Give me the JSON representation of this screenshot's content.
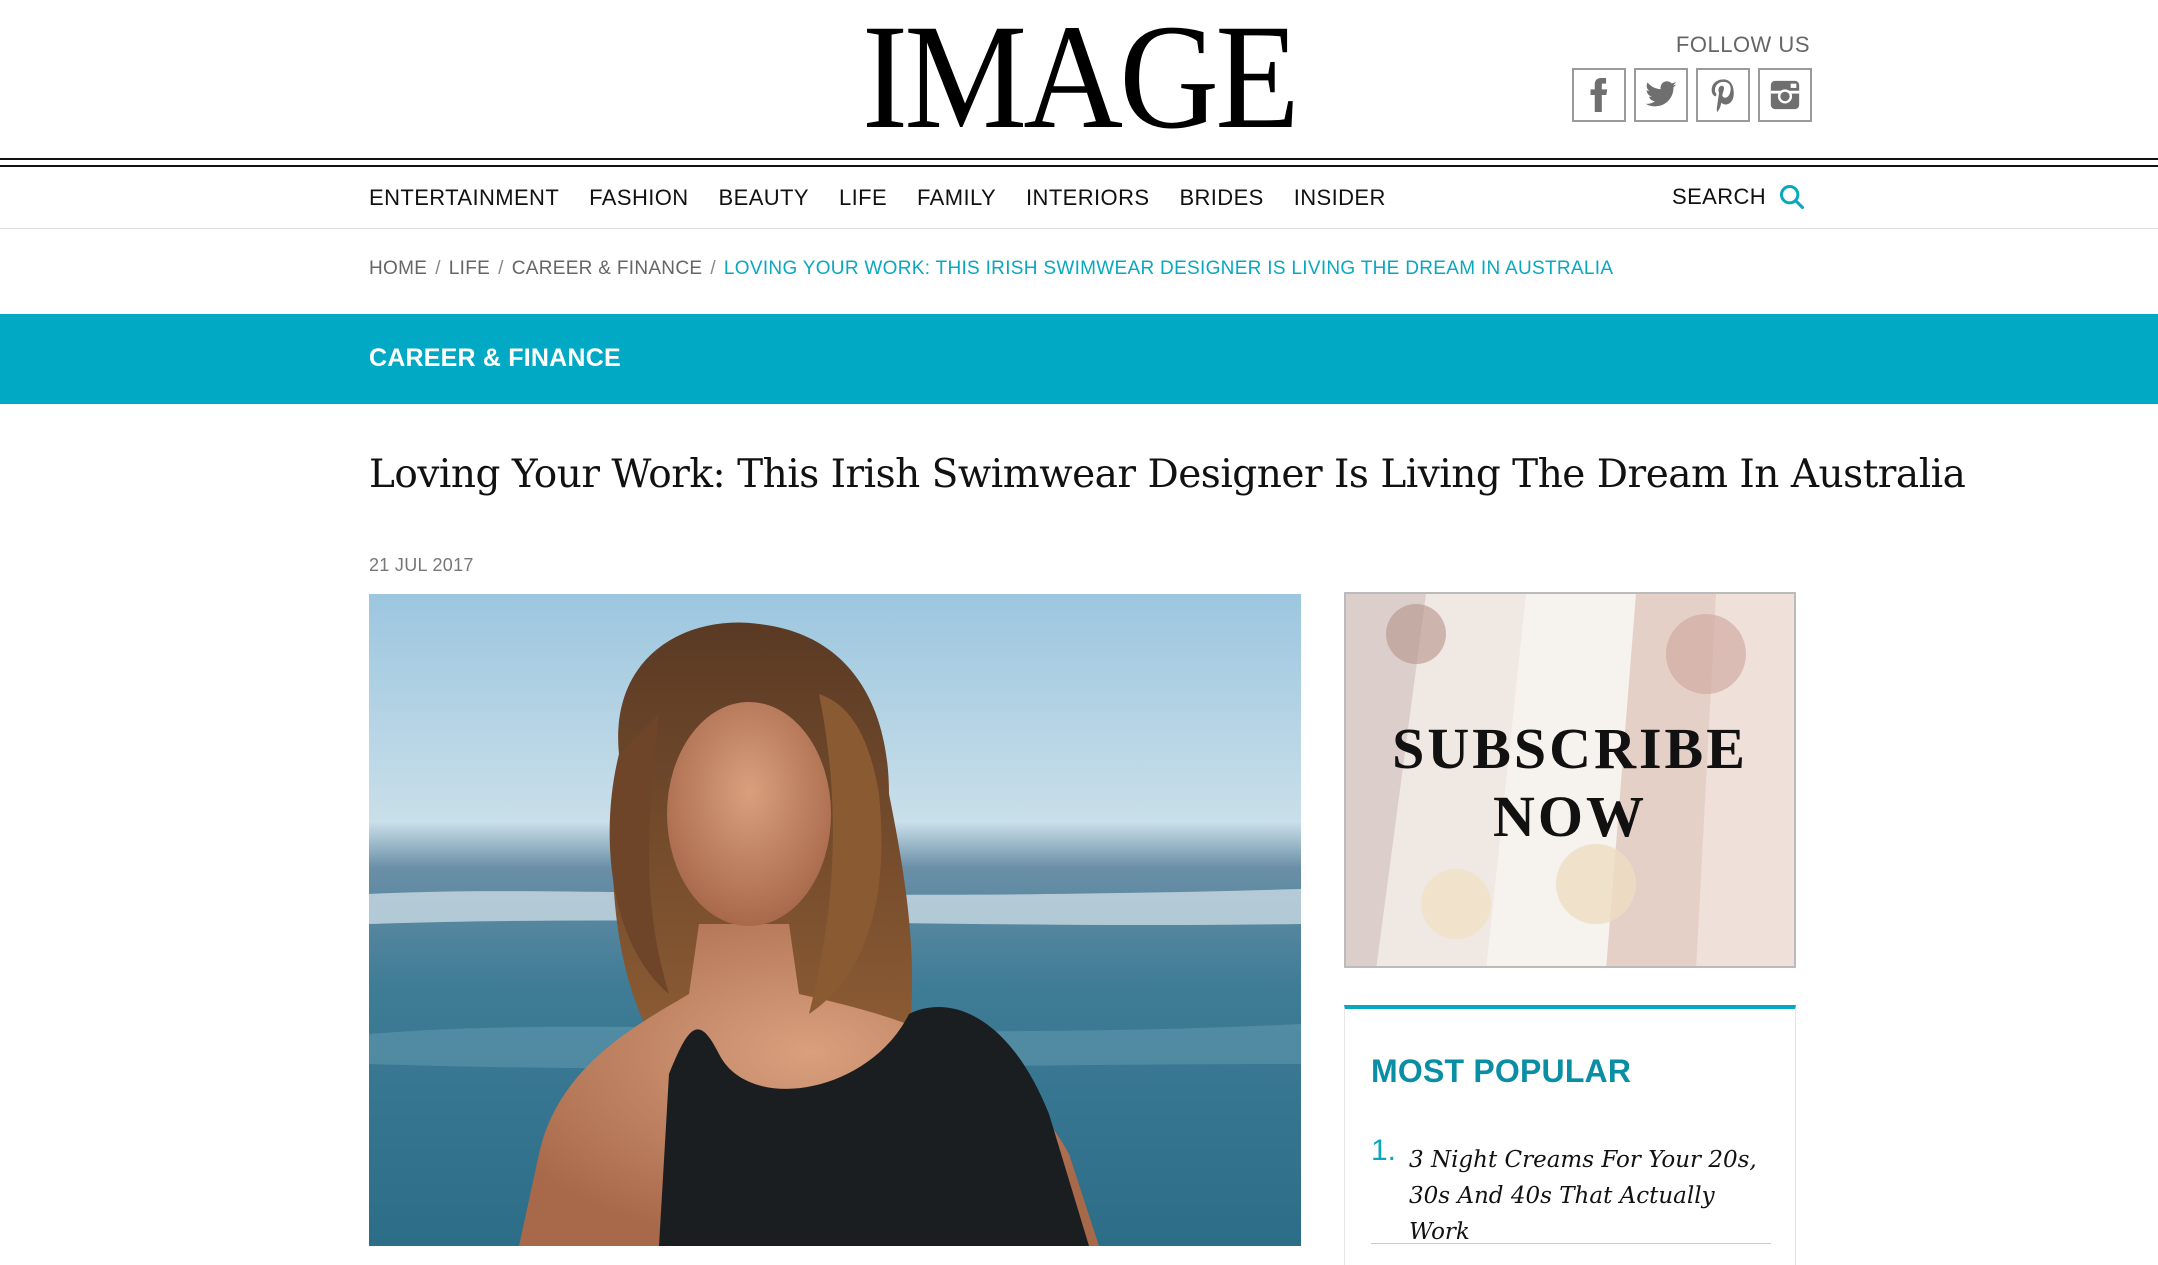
{
  "site": {
    "logo": "IMAGE",
    "follow_label": "FOLLOW US",
    "social_icons": [
      "facebook-icon",
      "twitter-icon",
      "pinterest-icon",
      "instagram-icon"
    ]
  },
  "nav": {
    "items": [
      "ENTERTAINMENT",
      "FASHION",
      "BEAUTY",
      "LIFE",
      "FAMILY",
      "INTERIORS",
      "BRIDES",
      "INSIDER"
    ],
    "search_label": "SEARCH"
  },
  "breadcrumb": {
    "items": [
      "HOME",
      "LIFE",
      "CAREER & FINANCE"
    ],
    "current": "LOVING YOUR WORK: THIS IRISH SWIMWEAR DESIGNER IS LIVING THE DREAM IN AUSTRALIA",
    "separator": "/"
  },
  "category_band": {
    "label": "CAREER & FINANCE",
    "color": "#01a9c5"
  },
  "article": {
    "title": "Loving Your Work: This Irish Swimwear Designer Is Living The Dream In Australia",
    "date": "21 JUL 2017"
  },
  "ad": {
    "line1": "SUBSCRIBE",
    "line2": "NOW"
  },
  "most_popular": {
    "title": "MOST POPULAR",
    "items": [
      {
        "number": "1.",
        "text": "3 Night Creams For Your 20s, 30s And 40s That Actually Work"
      }
    ]
  },
  "colors": {
    "accent": "#0aa7c1",
    "text": "#111111"
  }
}
